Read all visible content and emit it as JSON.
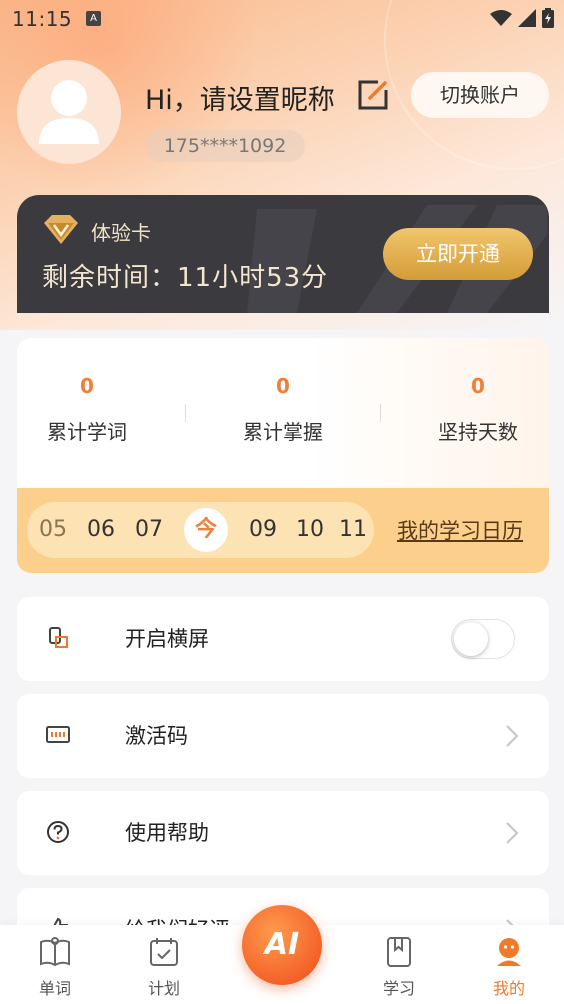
{
  "status_bar": {
    "time": "11:15",
    "notification_glyph": "A"
  },
  "profile": {
    "greeting": "Hi，请设置昵称",
    "phone": "175****1092",
    "switch_account_label": "切换账户"
  },
  "vip_card": {
    "label": "体验卡",
    "remaining_text": "剩余时间：11小时53分",
    "open_button_label": "立即开通"
  },
  "stats": {
    "items": [
      {
        "value": "0",
        "label": "累计学词"
      },
      {
        "value": "0",
        "label": "累计掌握"
      },
      {
        "value": "0",
        "label": "坚持天数"
      }
    ]
  },
  "calendar": {
    "dates": [
      "05",
      "06",
      "07",
      "今",
      "09",
      "10",
      "11"
    ],
    "link_label": "我的学习日历"
  },
  "settings": {
    "rows": [
      {
        "label": "开启横屏",
        "icon": "rotate-screen-icon",
        "toggle": false
      },
      {
        "label": "激活码",
        "icon": "activation-code-icon"
      },
      {
        "label": "使用帮助",
        "icon": "help-icon"
      },
      {
        "label": "给我们好评",
        "icon": "thumb-up-icon"
      }
    ]
  },
  "bottom_nav": {
    "items": [
      {
        "label": "单词",
        "icon": "book-icon"
      },
      {
        "label": "计划",
        "icon": "calendar-check-icon"
      },
      {
        "label": "AI",
        "icon": "ai-icon"
      },
      {
        "label": "学习",
        "icon": "bookmark-icon"
      },
      {
        "label": "我的",
        "icon": "profile-icon",
        "active": true
      }
    ]
  },
  "colors": {
    "accent": "#ef7f3a",
    "gold": "#d49c39",
    "card_dark": "#3b3a3f"
  }
}
